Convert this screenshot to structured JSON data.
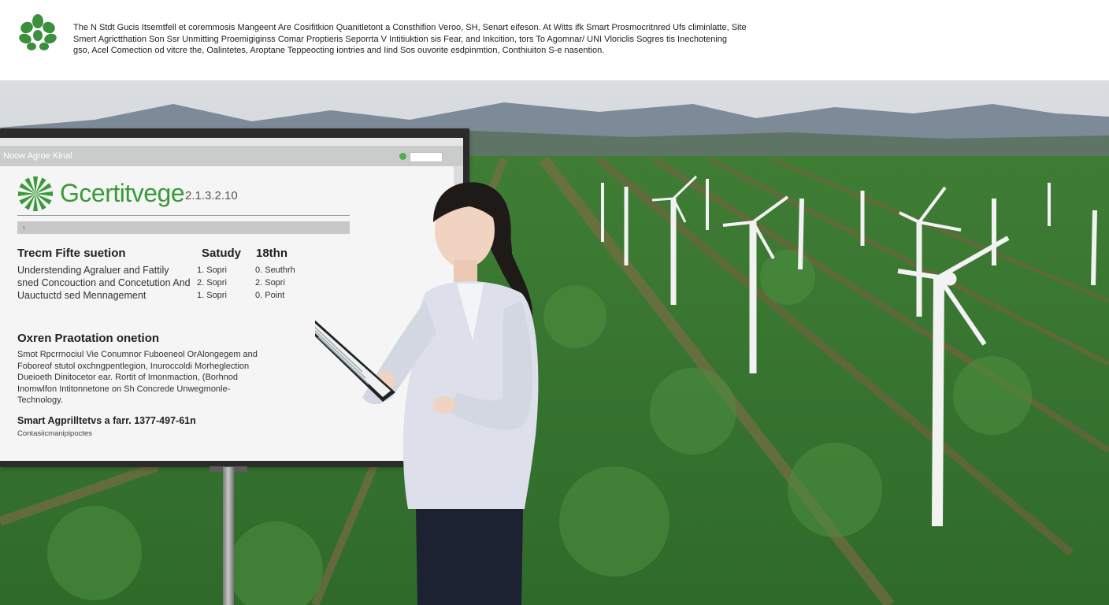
{
  "header": {
    "logo_icon": "leaf-cluster-icon",
    "logo_caption": "",
    "lines": [
      "The N Stdt Gucis Itsemtfell et coremmosis Mangeent Are Cosifitkion Quanitletont a Consthifion Veroo, SH, Senart eifeson. At Witts ifk Smart Prosmocritnred Ufs climinlatte, Site",
      "Smert Agrictthation Son Ssr Unmitting Proemigiginss Comar Proptieris Seporrta V Intitiuktion sis Fear, and Inkcition, tors To Agomnar/ UNI Vloriclis Sogres tis Inechotening",
      "gso, Acel Comection od vitcre the, Oalintetes, Aroptane Teppeocting iontries and Iind Sos ouvorite esdpinmtion, Conthiuiton S-e nasention."
    ]
  },
  "screen": {
    "tab_right": "",
    "app_title": "Noow Agroe Kinal",
    "brand_icon": "green-pinwheel-icon",
    "brand_name": "Gcertitvege",
    "brand_code": "2.1.3.2.10",
    "filter_icon": "pin-icon",
    "section1": {
      "heading": "Trecm Fifte suetion",
      "col1_head": "Satudy",
      "col2_head": "18thn",
      "description": "Understending Agraluer and Fattily sned Concouction and Concetution And Uauctuctd sed Mennagement",
      "col1_values": [
        "1. Sopri",
        "2. Sopri",
        "1. Sopri"
      ],
      "col2_values": [
        "0. Seuthrh",
        "2. Sopri",
        "0. Point"
      ]
    },
    "section2": {
      "heading": "Oxren Praotation onetion",
      "lines": [
        "Smot Rpcrrnociul Vie Conumnor Fuboeneol OrAlongegem and",
        "Foboreof stutol oxchngpentlegion, Inuroccoldi Morheglection",
        "Dueioeth Dinitocetor ear. Rortit of Imonmaction, (Borhnod",
        "Inomwlfon Intitonnetone on Sh Concrede Unwegmonle-",
        "Technology."
      ]
    },
    "section3": {
      "heading": "Smart Agprilltetvs a farr. 1377-497-61n",
      "sub": "Contasiicmanipipoctes"
    }
  },
  "scene": {
    "icons": [
      "tablet-icon",
      "wind-turbine-icon"
    ]
  }
}
